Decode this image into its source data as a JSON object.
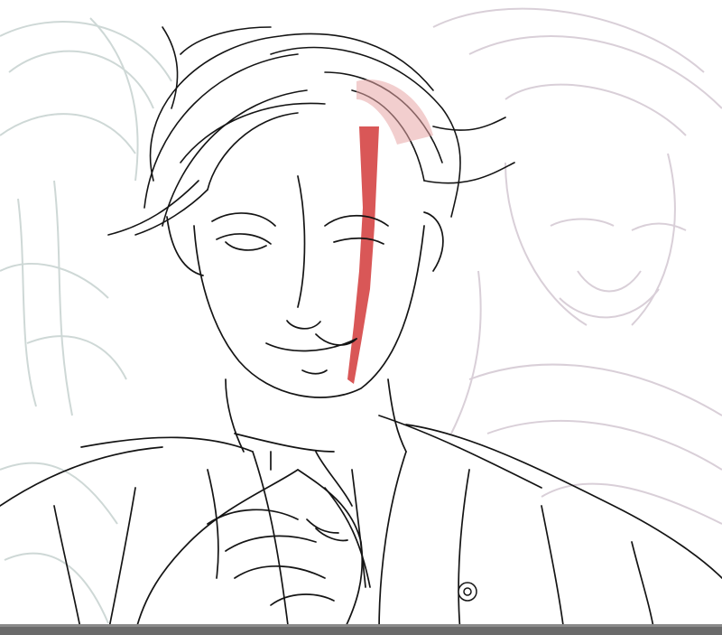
{
  "image": {
    "subject": "sketch-illustration",
    "colors": {
      "background": "#ffffff",
      "ink": "#141414",
      "ghost_left": "#c9d4d2",
      "ghost_right": "#d7cdd6",
      "blood_streak": "#d23a3a",
      "bottom_bar": "#6a6a6a"
    }
  }
}
